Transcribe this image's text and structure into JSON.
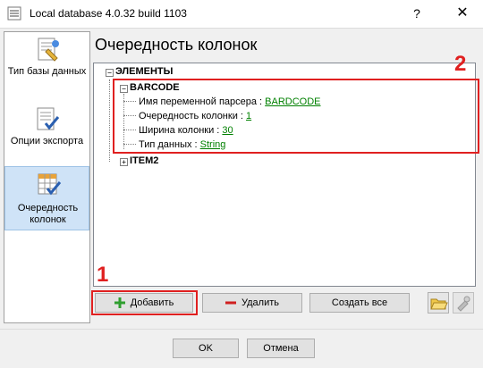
{
  "window": {
    "title": "Local database 4.0.32 build 1103",
    "help_glyph": "?",
    "close_glyph": "✕"
  },
  "sidebar": {
    "items": [
      {
        "label": "Тип базы данных",
        "icon": "database-type-icon"
      },
      {
        "label": "Опции экспорта",
        "icon": "export-options-icon"
      },
      {
        "label": "Очередность колонок",
        "icon": "column-order-icon",
        "active": true
      }
    ]
  },
  "main": {
    "heading": "Очередность колонок",
    "tree": {
      "root": {
        "toggle": "−",
        "label": "ЭЛЕМЕНТЫ"
      },
      "barcode": {
        "toggle": "−",
        "label": "BARCODE",
        "props": [
          {
            "label": "Имя переменной парсера : ",
            "value": "BARDCODE"
          },
          {
            "label": "Очередность колонки : ",
            "value": "1"
          },
          {
            "label": "Ширина колонки : ",
            "value": "30"
          },
          {
            "label": "Тип данных : ",
            "value": "String"
          }
        ]
      },
      "item2": {
        "toggle": "+",
        "label": "ITEM2"
      }
    },
    "annotations": {
      "one": "1",
      "two": "2",
      "color": "#e02020"
    },
    "buttons": {
      "add": "Добавить",
      "delete": "Удалить",
      "create_all": "Создать все"
    }
  },
  "footer": {
    "ok": "OK",
    "cancel": "Отмена"
  }
}
